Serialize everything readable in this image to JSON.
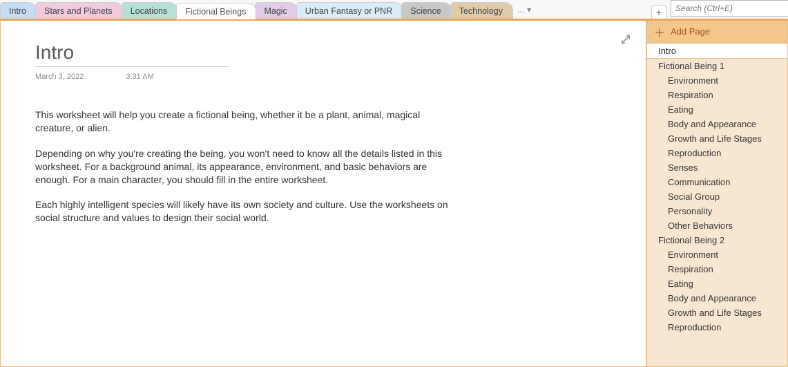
{
  "search": {
    "placeholder": "Search (Ctrl+E)"
  },
  "tabs": {
    "items": [
      {
        "label": "Intro"
      },
      {
        "label": "Stars and Planets"
      },
      {
        "label": "Locations"
      },
      {
        "label": "Fictional Beings"
      },
      {
        "label": "Magic"
      },
      {
        "label": "Urban Fantasy or PNR"
      },
      {
        "label": "Science"
      },
      {
        "label": "Technology"
      }
    ],
    "more": "...",
    "add_tooltip": "+"
  },
  "sidepanel": {
    "add_page": "Add Page",
    "pages": [
      {
        "label": "Intro",
        "level": 0,
        "selected": true
      },
      {
        "label": "Fictional Being 1",
        "level": 0
      },
      {
        "label": "Environment",
        "level": 1
      },
      {
        "label": "Respiration",
        "level": 1
      },
      {
        "label": "Eating",
        "level": 1
      },
      {
        "label": "Body and Appearance",
        "level": 1
      },
      {
        "label": "Growth and Life Stages",
        "level": 1
      },
      {
        "label": "Reproduction",
        "level": 1
      },
      {
        "label": "Senses",
        "level": 1
      },
      {
        "label": "Communication",
        "level": 1
      },
      {
        "label": "Social Group",
        "level": 1
      },
      {
        "label": "Personality",
        "level": 1
      },
      {
        "label": "Other Behaviors",
        "level": 1
      },
      {
        "label": "Fictional Being 2",
        "level": 0
      },
      {
        "label": "Environment",
        "level": 1
      },
      {
        "label": "Respiration",
        "level": 1
      },
      {
        "label": "Eating",
        "level": 1
      },
      {
        "label": "Body and Appearance",
        "level": 1
      },
      {
        "label": "Growth and Life Stages",
        "level": 1
      },
      {
        "label": "Reproduction",
        "level": 1
      }
    ]
  },
  "page": {
    "title": "Intro",
    "date": "March 3, 2022",
    "time": "3:31 AM",
    "body": {
      "p1": "This worksheet will help you create a fictional being, whether it be a plant, animal, magical creature, or alien.",
      "p2": "Depending on why you're creating the being, you won't need to know all the details listed in this worksheet. For a background animal, its appearance, environment, and basic behaviors are enough. For a main character, you should fill in the entire worksheet.",
      "p3": "Each highly intelligent species will likely have its own society and culture. Use the worksheets on social structure and values to design their social world."
    }
  }
}
